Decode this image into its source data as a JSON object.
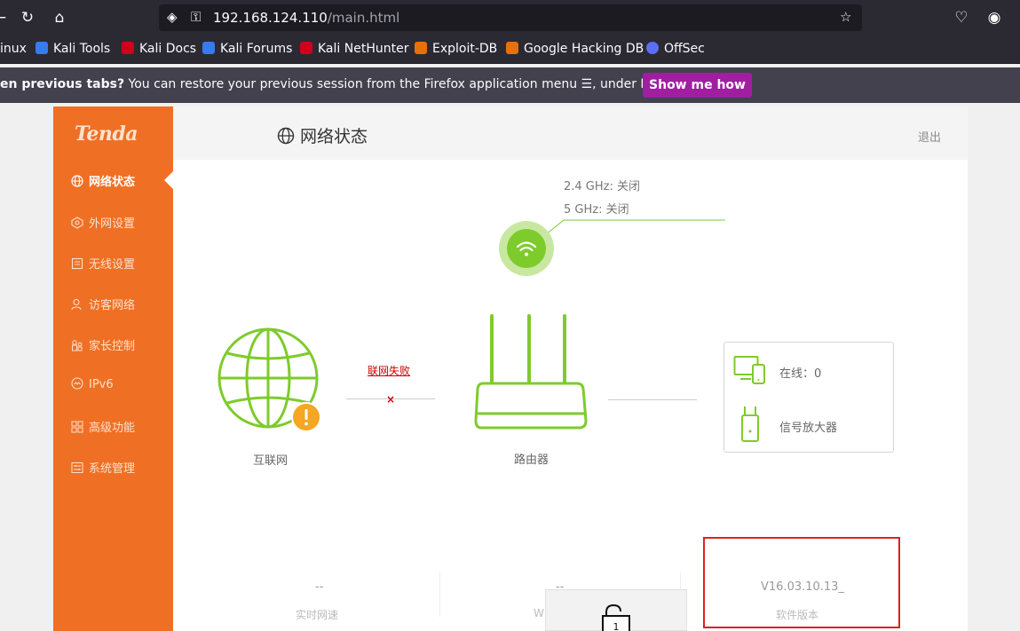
{
  "browser": {
    "url_host": "192.168.124.110",
    "url_path": "/main.html",
    "bookmarks": [
      {
        "label": "inux",
        "color": "#367bf0"
      },
      {
        "label": "Kali Tools",
        "color": "#367bf0"
      },
      {
        "label": "Kali Docs",
        "color": "#d0021b"
      },
      {
        "label": "Kali Forums",
        "color": "#367bf0"
      },
      {
        "label": "Kali NetHunter",
        "color": "#d0021b"
      },
      {
        "label": "Exploit-DB",
        "color": "#e8700a"
      },
      {
        "label": "Google Hacking DB",
        "color": "#e8700a"
      },
      {
        "label": "OffSec",
        "color": "#5b6ef5"
      }
    ],
    "notice_bold": "en previous tabs?",
    "notice_text": " You can restore your previous session from the Firefox application menu ☰, under History.",
    "notice_button": "Show me how"
  },
  "router": {
    "logo": "Tenda",
    "menu": [
      {
        "label": "网络状态",
        "icon": "globe-icon",
        "active": true
      },
      {
        "label": "外网设置",
        "icon": "wan-icon",
        "active": false
      },
      {
        "label": "无线设置",
        "icon": "wireless-icon",
        "active": false
      },
      {
        "label": "访客网络",
        "icon": "guest-icon",
        "active": false
      },
      {
        "label": "家长控制",
        "icon": "parental-icon",
        "active": false
      },
      {
        "label": "IPv6",
        "icon": "ipv6-icon",
        "active": false
      },
      {
        "label": "高级功能",
        "icon": "advanced-icon",
        "active": false
      },
      {
        "label": "系统管理",
        "icon": "system-icon",
        "active": false
      }
    ],
    "page_title": "网络状态",
    "logout": "退出",
    "wifi_24": "2.4 GHz: 关闭",
    "wifi_5": "5 GHz: 关闭",
    "internet_label": "互联网",
    "connection_status": "联网失败",
    "router_label": "路由器",
    "online_label": "在线：0",
    "extender_label": "信号放大器",
    "stats": [
      {
        "value": "--",
        "label": "实时网速"
      },
      {
        "value": "--",
        "label": "W"
      },
      {
        "value": "V16.03.10.13_",
        "label": "软件版本"
      }
    ],
    "popup_number": "1",
    "colors": {
      "sidebar": "#ef7025",
      "accent_green": "#7ecb2c",
      "warning": "#f5a623",
      "error": "#cc0000"
    }
  }
}
